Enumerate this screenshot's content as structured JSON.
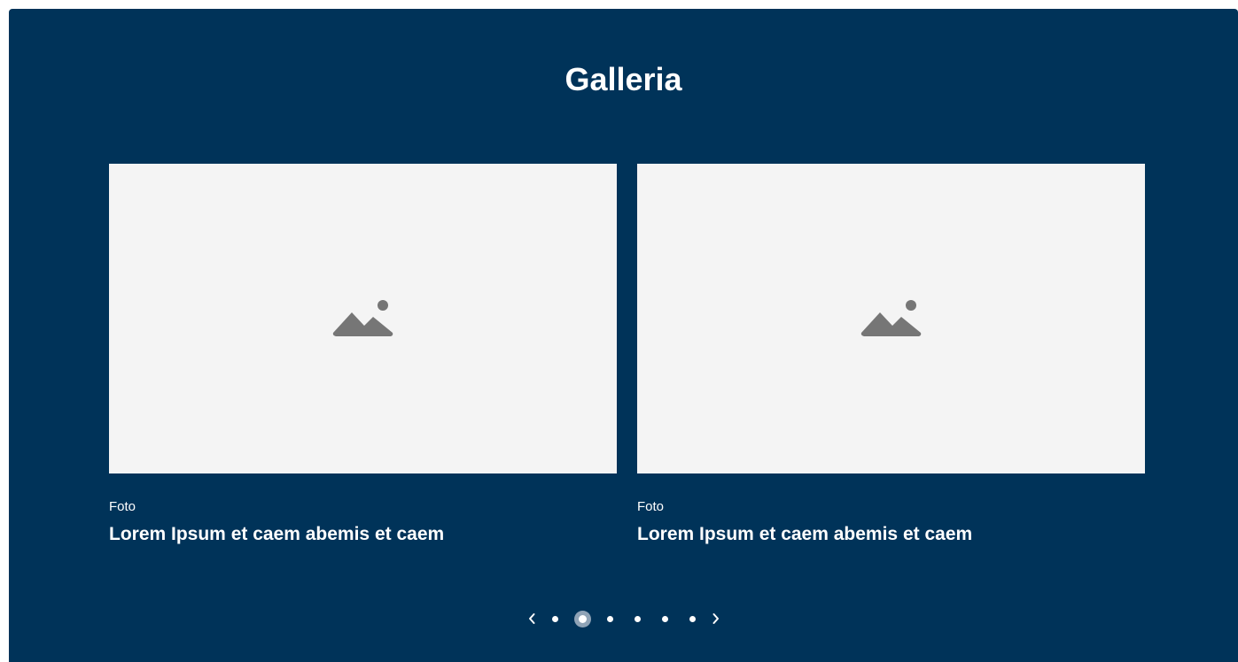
{
  "gallery": {
    "title": "Galleria",
    "cards": [
      {
        "image_icon": "image-placeholder-icon",
        "category": "Foto",
        "title": "Lorem Ipsum et caem abemis et caem"
      },
      {
        "image_icon": "image-placeholder-icon",
        "category": "Foto",
        "title": "Lorem Ipsum et caem abemis et caem"
      }
    ]
  },
  "pager": {
    "prev_icon": "chevron-left-icon",
    "next_icon": "chevron-right-icon",
    "dot_count": 6,
    "active_dot": 2
  },
  "colors": {
    "background": "#003359",
    "card_placeholder": "#f4f4f4",
    "placeholder_icon": "#767676",
    "text": "#ffffff",
    "active_dot_ring": "#8fa3b6"
  }
}
